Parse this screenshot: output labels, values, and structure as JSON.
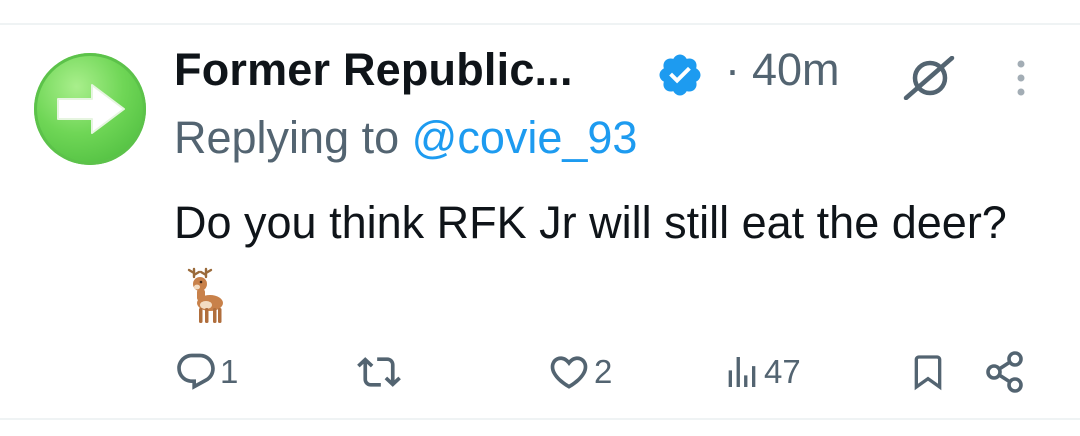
{
  "tweet": {
    "author_name": "Former Republic...",
    "verified": true,
    "separator": "·",
    "time": "40m",
    "reply_prefix": "Replying to ",
    "reply_handle": "@covie_93",
    "text": "Do you think RFK Jr will still eat the deer?",
    "emoji": "deer"
  },
  "icons": {
    "avatar": "right-arrow-icon",
    "verified": "verified-badge-icon",
    "grok": "grok-icon",
    "more": "more-icon",
    "reply": "reply-icon",
    "repost": "repost-icon",
    "like": "heart-icon",
    "views": "views-icon",
    "bookmark": "bookmark-icon",
    "share": "share-icon"
  },
  "actions": {
    "reply_count": "1",
    "repost_count": "",
    "like_count": "2",
    "view_count": "47"
  },
  "colors": {
    "text": "#0f1419",
    "secondary": "#536471",
    "link": "#1d9bf0",
    "avatar_green": "#5cc24a"
  }
}
